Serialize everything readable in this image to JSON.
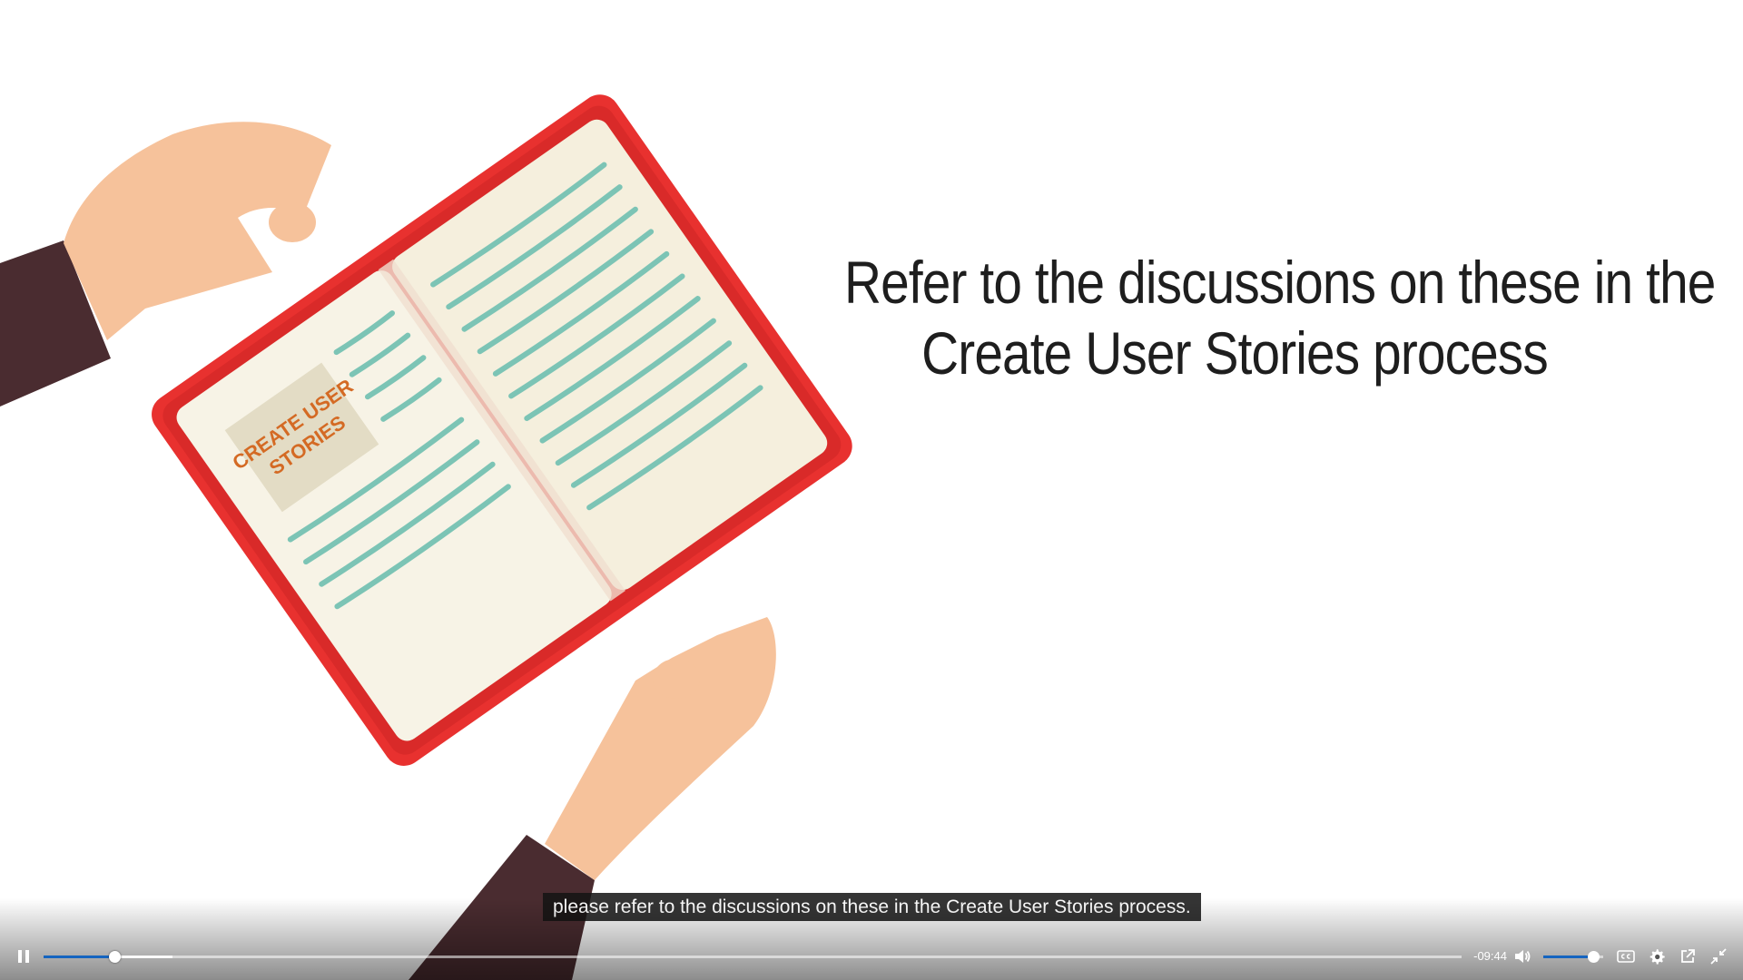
{
  "slide": {
    "heading_line1": "Refer to the discussions on these in the",
    "heading_line2": "Create User Stories process",
    "book_label_line1": "CREATE USER",
    "book_label_line2": "STORIES"
  },
  "captions": {
    "current_text": "please refer to the discussions on these in the Create User Stories process."
  },
  "player": {
    "play_state": "playing",
    "time_remaining": "-09:44",
    "progress_fraction": 0.05,
    "buffered_fraction": 0.091,
    "volume_fraction": 0.83,
    "accent_color": "#1565c0",
    "icons": {
      "play_pause": "pause-icon",
      "volume": "volume-icon",
      "captions": "closed-captions-icon",
      "settings": "gear-icon",
      "popout": "popout-icon",
      "fullscreen": "exit-fullscreen-icon"
    }
  },
  "colors": {
    "book_cover": "#e8312f",
    "book_pages": "#f7f3e6",
    "text_lines": "#7cc4b5",
    "skin": "#f6c29b",
    "sleeve": "#4a2c30",
    "label_text": "#d46a24"
  }
}
